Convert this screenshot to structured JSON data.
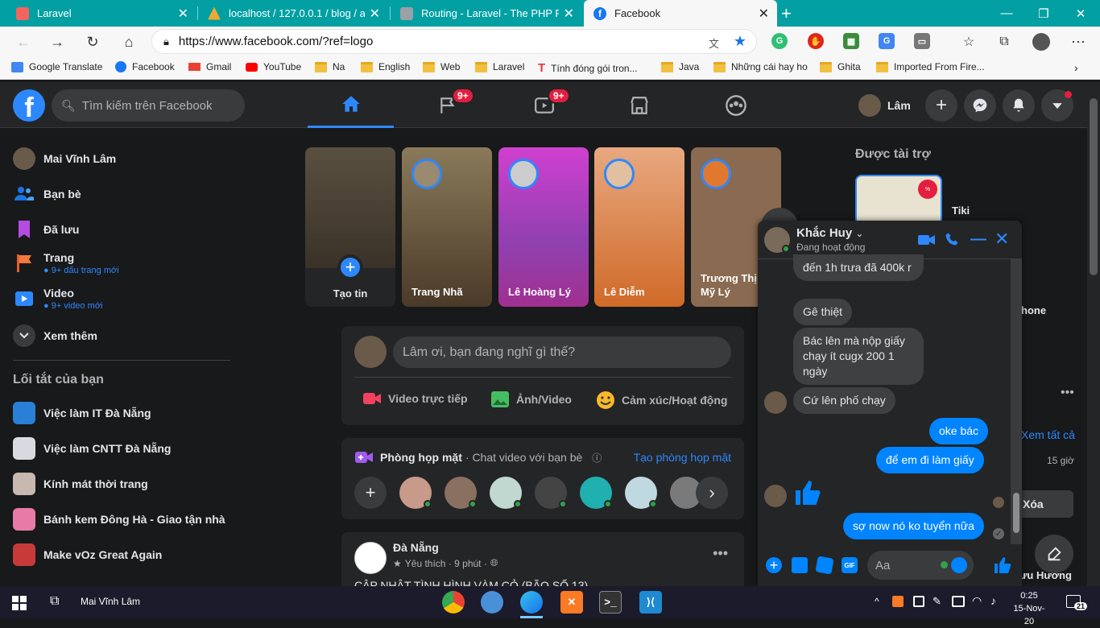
{
  "browser": {
    "tabs": [
      {
        "title": "Laravel",
        "color": "#f4645f"
      },
      {
        "title": "localhost / 127.0.0.1 / blog / artic",
        "color": "#f0a830"
      },
      {
        "title": "Routing - Laravel - The PHP Fram",
        "color": "#9aa0a6"
      },
      {
        "title": "Facebook",
        "color": "#1877f2"
      }
    ],
    "url": "https://www.facebook.com/?ref=logo",
    "bookmarks": [
      "Google Translate",
      "Facebook",
      "Gmail",
      "YouTube",
      "Na",
      "English",
      "Web",
      "Laravel",
      "Tính đóng gói tron...",
      "Java",
      "Những cái hay ho",
      "Ghita",
      "Imported From Fire..."
    ]
  },
  "header": {
    "search_placeholder": "Tìm kiếm trên Facebook",
    "groups_badge": "9+",
    "watch_badge": "9+",
    "profile_name": "Lâm"
  },
  "sidebar": {
    "items": [
      {
        "label": "Mai Vĩnh Lâm",
        "sub": "",
        "icon": "profile-avatar"
      },
      {
        "label": "Bạn bè",
        "sub": "",
        "icon": "friends-icon"
      },
      {
        "label": "Đã lưu",
        "sub": "",
        "icon": "bookmark-icon"
      },
      {
        "label": "Trang",
        "sub": "9+ dấu trang mới",
        "icon": "flag-icon"
      },
      {
        "label": "Video",
        "sub": "9+ video mới",
        "icon": "video-icon"
      },
      {
        "label": "Xem thêm",
        "sub": "",
        "icon": "chevron-down-icon"
      }
    ],
    "shortcuts_title": "Lối tắt của bạn",
    "shortcuts": [
      "Việc làm IT Đà Nẵng",
      "Việc làm CNTT Đà Nẵng",
      "Kính mát thời trang",
      "Bánh kem Đông Hà - Giao tận nhà",
      "Make vOz Great Again"
    ]
  },
  "stories": [
    {
      "name": "Tạo tin",
      "color": "#4a4030"
    },
    {
      "name": "Trang Nhã",
      "color": "#6b5a3e"
    },
    {
      "name": "Lê Hoàng Lý",
      "color": "#b040c0"
    },
    {
      "name": "Lê Diễm",
      "color": "#d06a28"
    },
    {
      "name": "Trương Thị Mỹ Lý",
      "color": "#8a6a50"
    }
  ],
  "composer": {
    "placeholder": "Lâm ơi, bạn đang nghĩ gì thế?",
    "live": "Video trực tiếp",
    "photo": "Ảnh/Video",
    "feeling": "Cảm xúc/Hoạt động"
  },
  "rooms": {
    "title": "Phòng họp mặt",
    "subtitle": "· Chat video với bạn bè",
    "create": "Tạo phòng họp mặt"
  },
  "post": {
    "author": "Đà Nẵng",
    "meta": "Yêu thích · 9 phút ·",
    "text": "CẬP NHẬT TÌNH HÌNH VÀM CỎ (BÃO SỐ 13)"
  },
  "right": {
    "sponsored": "Được tài trợ",
    "ad_name": "Tiki",
    "partial_phone": "hone",
    "see_all": "Xem tất cả",
    "time": "15 giờ",
    "delete": "Xóa",
    "partial_name": "ưu Hương"
  },
  "chat": {
    "name": "Khắc Huy",
    "status": "Đang hoạt động",
    "messages": [
      {
        "dir": "in",
        "text": "đến 1h trưa đã 400k r"
      },
      {
        "dir": "in",
        "text": "Gê thiệt"
      },
      {
        "dir": "in",
        "text": "Bác lên mà nộp giấy chạy ít cugx 200 1 ngày"
      },
      {
        "dir": "in",
        "text": "Cứ lên phố chạy"
      },
      {
        "dir": "out",
        "text": "oke bác"
      },
      {
        "dir": "out",
        "text": "để em đi làm giấy"
      },
      {
        "dir": "out",
        "text": "sợ now nó ko tuyển nữa"
      }
    ],
    "input_placeholder": "Aa"
  },
  "taskbar": {
    "user": "Mai Vĩnh Lâm",
    "time": "0:25",
    "date": "15-Nov-20",
    "notif_count": "21"
  }
}
